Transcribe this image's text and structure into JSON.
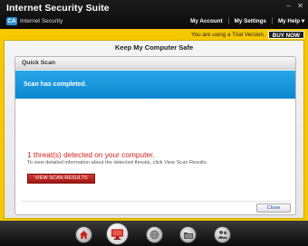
{
  "window": {
    "title": "Internet Security Suite",
    "brand_logo": "CA",
    "brand_name": "Internet Security",
    "controls": [
      "minimize",
      "maximize",
      "close"
    ]
  },
  "top_nav": {
    "account": "My Account",
    "settings": "My Settings",
    "help": "My Help ▾"
  },
  "trial": {
    "text": "You are using a Trial Version.",
    "buy_label": "BUY NOW"
  },
  "page": {
    "title": "Keep My Computer Safe"
  },
  "panel": {
    "title": "Quick Scan",
    "status": "Scan has completed.",
    "threat_text": "1 threat(s) detected on your computer.",
    "threat_detail": "To view detailed information about the detected threats, click View Scan Results.",
    "view_button": "VIEW SCAN RESULTS",
    "close_button": "Close"
  },
  "dock": {
    "items": [
      {
        "name": "home-icon",
        "active": false,
        "color": "#c8231c"
      },
      {
        "name": "monitor-icon",
        "active": true,
        "color": "#c8231c"
      },
      {
        "name": "globe-icon",
        "active": false,
        "color": "#777777"
      },
      {
        "name": "folder-icon",
        "active": false,
        "color": "#555555"
      },
      {
        "name": "people-icon",
        "active": false,
        "color": "#555555"
      }
    ]
  },
  "colors": {
    "accent_yellow": "#f6c800",
    "banner_blue": "#0b86cf",
    "threat_red": "#d21d1d"
  }
}
